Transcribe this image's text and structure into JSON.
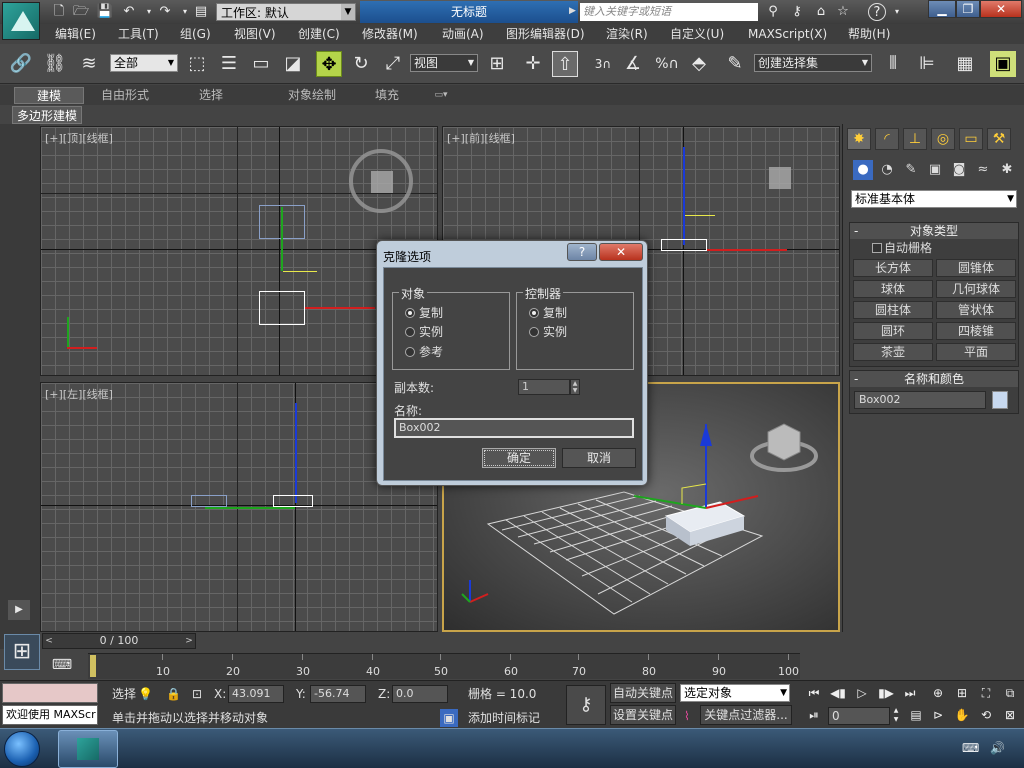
{
  "titlebar": {
    "workspace_label": "工作区: 默认",
    "doc_title": "无标题",
    "search_placeholder": "键入关键字或短语"
  },
  "menu": [
    "编辑(E)",
    "工具(T)",
    "组(G)",
    "视图(V)",
    "创建(C)",
    "修改器(M)",
    "动画(A)",
    "图形编辑器(D)",
    "渲染(R)",
    "自定义(U)",
    "MAXScript(X)",
    "帮助(H)"
  ],
  "toolbar": {
    "selection_filter": "全部",
    "ref_coord": "视图",
    "named_selection": "创建选择集",
    "snap_3": "3",
    "snap_percent": "%"
  },
  "ribbon": {
    "tabs": [
      "建模",
      "自由形式",
      "选择",
      "对象绘制",
      "填充"
    ],
    "active_tab": "建模",
    "sub": "多边形建模"
  },
  "viewports": {
    "top": "[+][顶][线框]",
    "front": "[+][前][线框]",
    "left": "[+][左][线框]"
  },
  "command_panel": {
    "category": "标准基本体",
    "object_type_title": "对象类型",
    "autogrid": "自动栅格",
    "objects": [
      "长方体",
      "圆锥体",
      "球体",
      "几何球体",
      "圆柱体",
      "管状体",
      "圆环",
      "四棱锥",
      "茶壶",
      "平面"
    ],
    "name_color_title": "名称和颜色",
    "object_name": "Box002",
    "object_color": "#c8d9ef"
  },
  "dialog": {
    "title": "克隆选项",
    "help": "?",
    "close": "✕",
    "object_group": "对象",
    "object_options": [
      "复制",
      "实例",
      "参考"
    ],
    "object_selected": 0,
    "controller_group": "控制器",
    "controller_options": [
      "复制",
      "实例"
    ],
    "controller_selected": 0,
    "copies_label": "副本数:",
    "copies_value": "1",
    "name_label": "名称:",
    "name_value": "Box002",
    "ok": "确定",
    "cancel": "取消"
  },
  "timeline": {
    "range": "0 / 100",
    "ticks": [
      "10",
      "20",
      "30",
      "40",
      "50",
      "60",
      "70",
      "80",
      "90",
      "100"
    ]
  },
  "status": {
    "welcome": "欢迎使用 MAXScr",
    "selection": "选择",
    "x_label": "X:",
    "x": "43.091",
    "y_label": "Y:",
    "y": "-56.74",
    "z_label": "Z:",
    "z": "0.0",
    "grid": "栅格 = 10.0",
    "auto_key": "自动关键点",
    "set_key": "设置关键点",
    "key_mode": "选定对象",
    "key_filter": "关键点过滤器...",
    "frame": "0",
    "prompt": "单击并拖动以选择并移动对象",
    "add_time_tag": "添加时间标记"
  }
}
